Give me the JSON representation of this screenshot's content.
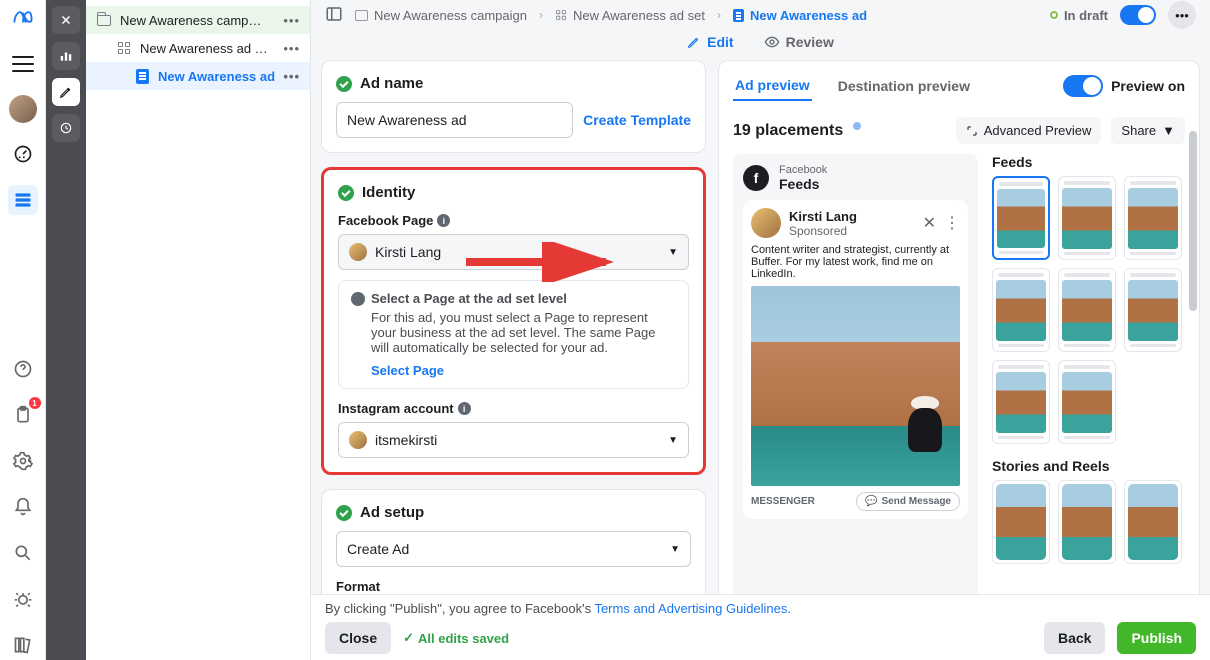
{
  "nav": {
    "help_label": "Help"
  },
  "tree": {
    "items": [
      {
        "label": "New Awareness camp…"
      },
      {
        "label": "New Awareness ad …"
      },
      {
        "label": "New Awareness ad"
      }
    ]
  },
  "breadcrumb": {
    "campaign": "New Awareness campaign",
    "adset": "New Awareness ad set",
    "ad": "New Awareness ad"
  },
  "status": {
    "draft": "In draft"
  },
  "tabs": {
    "edit": "Edit",
    "review": "Review"
  },
  "ad": {
    "name_section": "Ad name",
    "name_value": "New Awareness ad",
    "create_template": "Create Template",
    "identity": {
      "title": "Identity",
      "fb_label": "Facebook Page",
      "fb_value": "Kirsti Lang",
      "tip_title": "Select a Page at the ad set level",
      "tip_body": "For this ad, you must select a Page to represent your business at the ad set level. The same Page will automatically be selected for your ad.",
      "tip_link": "Select Page",
      "ig_label": "Instagram account",
      "ig_value": "itsmekirsti"
    },
    "setup": {
      "title": "Ad setup",
      "select": "Create Ad",
      "format": "Format"
    }
  },
  "preview": {
    "tab1": "Ad preview",
    "tab2": "Destination preview",
    "toggle": "Preview on",
    "placements": "19 placements",
    "adv": "Advanced Preview",
    "share": "Share",
    "feeds_title": "Feeds",
    "feeds_sub": "Facebook",
    "post": {
      "name": "Kirsti Lang",
      "sub": "Sponsored",
      "text": "Content writer and strategist, currently at Buffer. For my latest work, find me on LinkedIn.",
      "msgr": "MESSENGER",
      "send": "Send Message"
    },
    "stories": "Stories and Reels"
  },
  "footer": {
    "disc_prefix": "By clicking \"Publish\", you agree to Facebook's ",
    "disc_link": "Terms and Advertising Guidelines",
    "close": "Close",
    "saved": "All edits saved",
    "back": "Back",
    "publish": "Publish"
  }
}
